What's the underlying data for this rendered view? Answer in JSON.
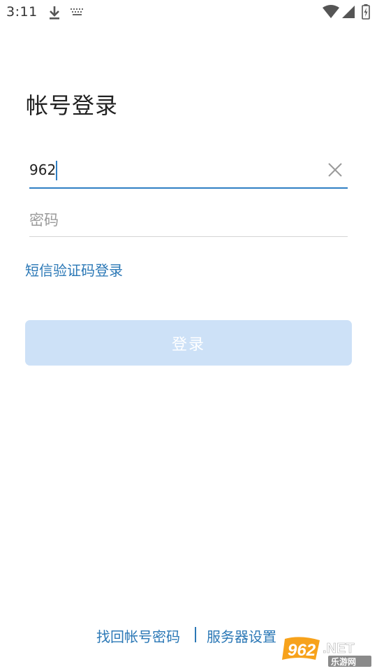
{
  "status_bar": {
    "time": "3:11",
    "icons": [
      "download-icon",
      "keyboard-icon",
      "wifi-icon",
      "signal-icon",
      "battery-charging-icon"
    ]
  },
  "title": "帐号登录",
  "account_field": {
    "value": "962",
    "clear_icon": "clear-icon"
  },
  "password_field": {
    "value": "",
    "placeholder": "密码"
  },
  "sms_login_link": "短信验证码登录",
  "login_button": {
    "label": "登录",
    "enabled": false
  },
  "footer": {
    "find_password": "找回帐号密码",
    "divider": "|",
    "server_settings": "服务器设置"
  },
  "watermark": {
    "brand": "962.NET",
    "subtitle": "乐游网"
  },
  "colors": {
    "accent": "#2f7fc4",
    "link": "#2b78b6",
    "button_disabled_bg": "#cde1f7",
    "button_text": "#ffffff",
    "placeholder": "#9a9a9a",
    "divider": "#d5d5d5"
  }
}
